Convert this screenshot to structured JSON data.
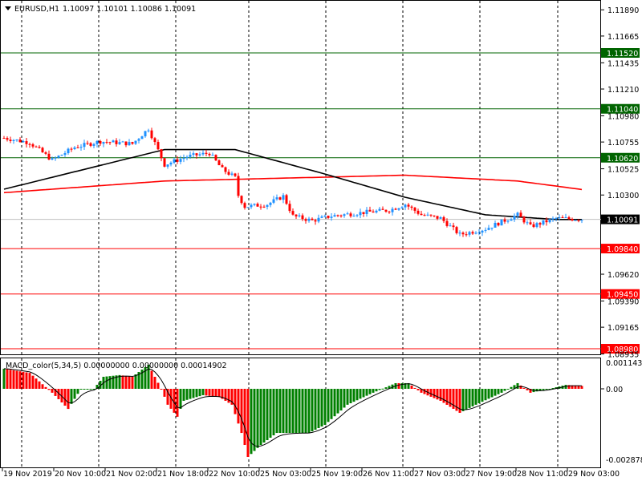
{
  "header": {
    "symbol": "EURUSD,H1",
    "ohlc": "1.10097 1.10101 1.10086 1.10091"
  },
  "macd": {
    "title": "MACD_color(5,34,5) 0.00000000 0.00000000 0.00014902",
    "scale_labels": [
      "0.0011432",
      "0.00",
      "-0.002878"
    ],
    "scale_values": [
      0.0011432,
      0,
      -0.002878
    ]
  },
  "price_axis": {
    "ticks": [
      "1.11890",
      "1.11665",
      "1.11435",
      "1.11210",
      "1.10980",
      "1.10755",
      "1.10525",
      "1.10300",
      "1.09620",
      "1.09390",
      "1.09165",
      "1.08935"
    ]
  },
  "levels": [
    {
      "price": "1.11520",
      "color": "#006400"
    },
    {
      "price": "1.11040",
      "color": "#006400"
    },
    {
      "price": "1.10620",
      "color": "#006400"
    },
    {
      "price": "1.10091",
      "color": "#000000",
      "line": "#c0c0c0"
    },
    {
      "price": "1.09840",
      "color": "#ff0000"
    },
    {
      "price": "1.09450",
      "color": "#ff0000"
    },
    {
      "price": "1.08980",
      "color": "#ff0000"
    }
  ],
  "time_axis": [
    "19 Nov 2019",
    "20 Nov 10:00",
    "21 Nov 02:00",
    "21 Nov 18:00",
    "22 Nov 10:00",
    "25 Nov 03:00",
    "25 Nov 19:00",
    "26 Nov 11:00",
    "27 Nov 03:00",
    "27 Nov 19:00",
    "28 Nov 11:00",
    "29 Nov 03:00"
  ],
  "colors": {
    "up": "#1e90ff",
    "down": "#ff0000",
    "hist_up": "#008000",
    "hist_down": "#ff0000"
  },
  "chart_data": {
    "type": "candlestick",
    "close_path": [
      [
        0,
        1.1079
      ],
      [
        8,
        1.1075
      ],
      [
        15,
        1.106
      ],
      [
        22,
        1.1071
      ],
      [
        30,
        1.1076
      ],
      [
        40,
        1.1074
      ],
      [
        45,
        1.1087
      ],
      [
        50,
        1.1056
      ],
      [
        57,
        1.1063
      ],
      [
        64,
        1.1066
      ],
      [
        68,
        1.1052
      ],
      [
        72,
        1.1045
      ],
      [
        72.5,
        1.1032
      ],
      [
        75,
        1.102
      ],
      [
        82,
        1.1022
      ],
      [
        87,
        1.1029
      ],
      [
        90,
        1.1012
      ],
      [
        96,
        1.1008
      ],
      [
        102,
        1.1012
      ],
      [
        112,
        1.1015
      ],
      [
        120,
        1.1017
      ],
      [
        125,
        1.1022
      ],
      [
        130,
        1.1013
      ],
      [
        136,
        1.101
      ],
      [
        142,
        1.0996
      ],
      [
        150,
        1.1001
      ],
      [
        160,
        1.1013
      ],
      [
        164,
        1.1003
      ],
      [
        172,
        1.101
      ],
      [
        182,
        1.10091
      ]
    ],
    "ma_slow": [
      [
        0,
        1.1035
      ],
      [
        50,
        1.1069
      ],
      [
        72,
        1.1069
      ],
      [
        100,
        1.1048
      ],
      [
        125,
        1.1028
      ],
      [
        150,
        1.1013
      ],
      [
        172,
        1.1009
      ],
      [
        182,
        1.1009
      ]
    ],
    "ma_long": [
      [
        0,
        1.1032
      ],
      [
        50,
        1.1042
      ],
      [
        125,
        1.1047
      ],
      [
        160,
        1.1042
      ],
      [
        182,
        1.1034
      ]
    ],
    "macd_hist": [
      [
        0,
        0.00082
      ],
      [
        8,
        0.00065
      ],
      [
        15,
        -0.00016
      ],
      [
        20,
        -0.00082
      ],
      [
        24,
        0
      ],
      [
        28,
        0
      ],
      [
        31,
        0.00049
      ],
      [
        36,
        0.00056
      ],
      [
        40,
        0.00049
      ],
      [
        45,
        0.00098
      ],
      [
        49,
        0
      ],
      [
        51,
        -0.00065
      ],
      [
        54,
        -0.00114
      ],
      [
        56,
        -0.00049
      ],
      [
        62,
        -0.00026
      ],
      [
        67,
        -0.00033
      ],
      [
        71,
        -0.00065
      ],
      [
        74,
        -0.0018
      ],
      [
        76,
        -0.00278
      ],
      [
        80,
        -0.00229
      ],
      [
        85,
        -0.0018
      ],
      [
        95,
        -0.0018
      ],
      [
        100,
        -0.00147
      ],
      [
        107,
        -0.00065
      ],
      [
        115,
        -0.00016
      ],
      [
        122,
        0.00023
      ],
      [
        126,
        0.00023
      ],
      [
        130,
        -0.00016
      ],
      [
        136,
        -0.00049
      ],
      [
        142,
        -0.00098
      ],
      [
        147,
        -0.00065
      ],
      [
        155,
        -0.00016
      ],
      [
        160,
        0.00023
      ],
      [
        164,
        -0.00016
      ],
      [
        170,
        0
      ],
      [
        175,
        0.00016
      ],
      [
        182,
        0.0001
      ]
    ],
    "price_range": [
      1.0887,
      1.1198
    ],
    "macd_range": [
      -0.00305,
      0.00125
    ]
  }
}
